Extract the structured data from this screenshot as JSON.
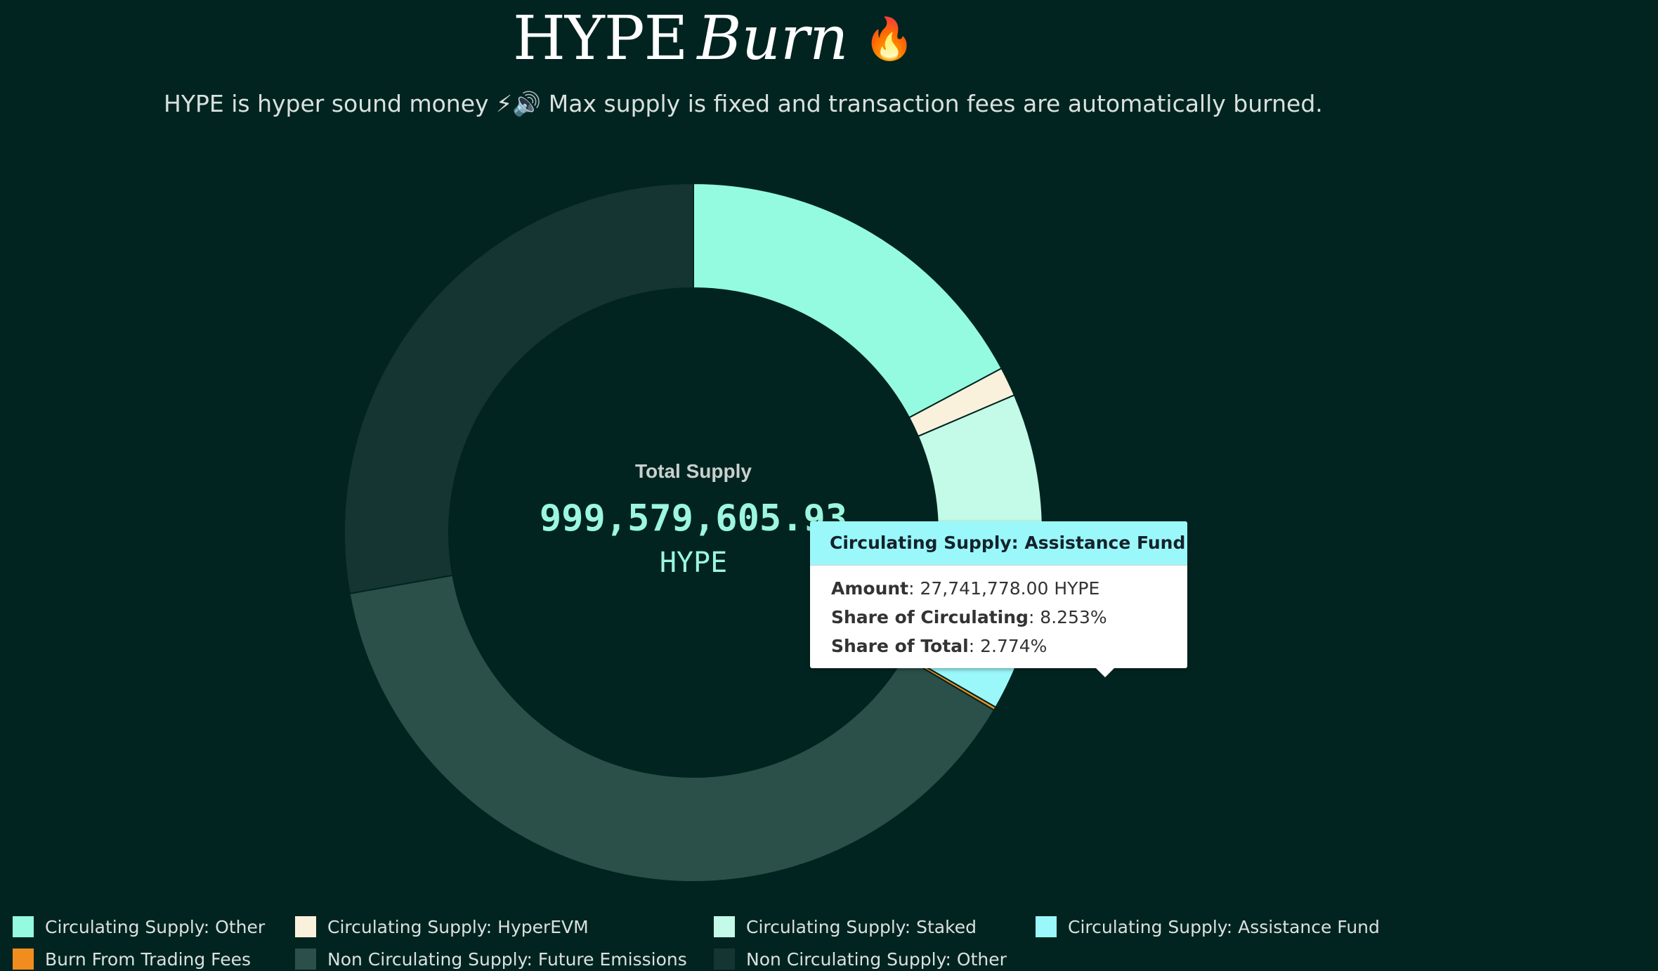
{
  "header": {
    "title_main": "HYPE",
    "title_italic": "Burn",
    "title_emoji": "🔥",
    "subtitle": "HYPE is hyper sound money ⚡🔊 Max supply is fixed and transaction fees are automatically burned."
  },
  "center": {
    "title": "Total Supply",
    "value": "999,579,605.93",
    "unit": "HYPE"
  },
  "tooltip": {
    "title": "Circulating Supply: Assistance Fund",
    "rows": [
      {
        "label": "Amount",
        "value": ": 27,741,778.00 HYPE"
      },
      {
        "label": "Share of Circulating",
        "value": ": 8.253%"
      },
      {
        "label": "Share of Total",
        "value": ": 2.774%"
      }
    ],
    "color": "#9af8fb"
  },
  "chart_data": {
    "type": "pie",
    "style": "donut",
    "total": 999579605.93,
    "unit": "HYPE",
    "start_angle_deg": 0,
    "direction": "clockwise",
    "series": [
      {
        "name": "Circulating Supply: Other",
        "value": 172000000,
        "color": "#94fbe0"
      },
      {
        "name": "Circulating Supply: HyperEVM",
        "value": 13500000,
        "color": "#f9f1dc"
      },
      {
        "name": "Circulating Supply: Staked",
        "value": 120000000,
        "color": "#c3fbe8"
      },
      {
        "name": "Circulating Supply: Assistance Fund",
        "value": 27741778.0,
        "color": "#9af8fb"
      },
      {
        "name": "Burn From Trading Fees",
        "value": 1500000,
        "color": "#f18d1f"
      },
      {
        "name": "Non Circulating Supply: Future Emissions",
        "value": 387000000,
        "color": "#2b504a"
      },
      {
        "name": "Non Circulating Supply: Other",
        "value": 277837827.93,
        "color": "#153532"
      }
    ],
    "legend_position": "bottom"
  }
}
